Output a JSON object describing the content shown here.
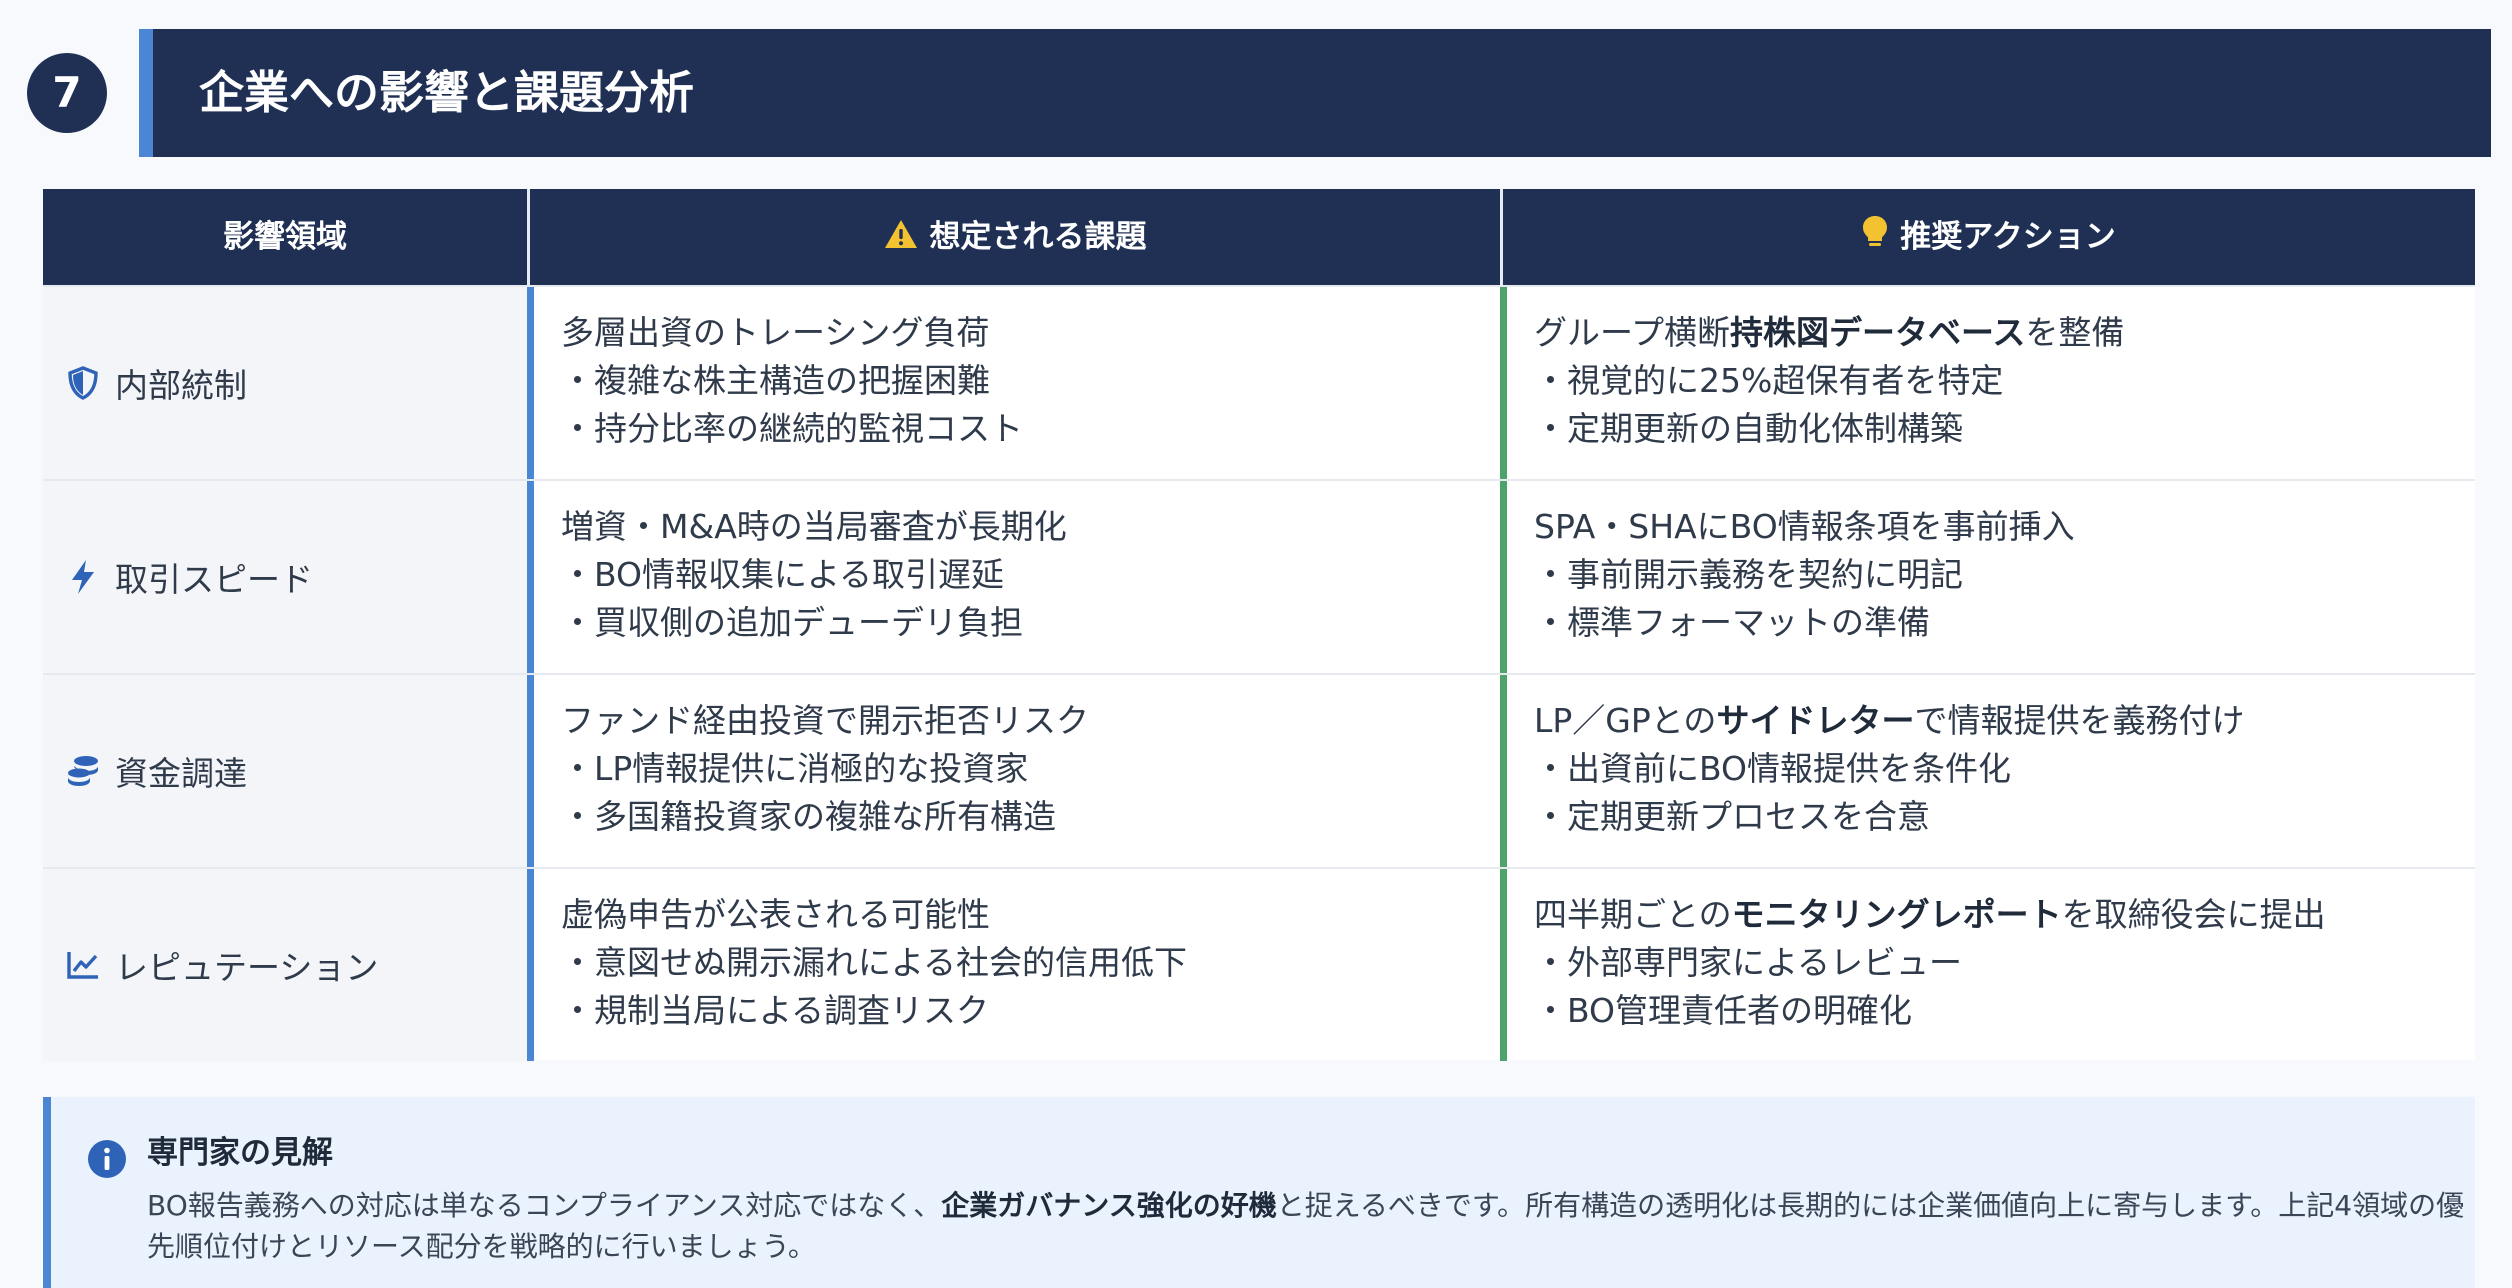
{
  "section": {
    "number": "7",
    "title": "企業への影響と課題分析"
  },
  "table": {
    "headers": {
      "area": "影響領域",
      "issues": "想定される課題",
      "actions": "推奨アクション"
    },
    "rows": [
      {
        "icon": "shield-icon",
        "area": "内部統制",
        "issues": [
          "多層出資のトレーシング負荷",
          "・複雑な株主構造の把握困難",
          "・持分比率の継続的監視コスト"
        ],
        "action_head": {
          "pre": "グループ横断",
          "bold": "持株図データベース",
          "post": "を整備"
        },
        "actions": [
          "・視覚的に25%超保有者を特定",
          "・定期更新の自動化体制構築"
        ]
      },
      {
        "icon": "lightning-icon",
        "area": "取引スピード",
        "issues": [
          "増資・M&A時の当局審査が長期化",
          "・BO情報収集による取引遅延",
          "・買収側の追加デューデリ負担"
        ],
        "action_head": {
          "pre": "SPA・SHAにBO情報条項を事前挿入",
          "bold": "",
          "post": ""
        },
        "actions": [
          "・事前開示義務を契約に明記",
          "・標準フォーマットの準備"
        ]
      },
      {
        "icon": "coins-icon",
        "area": "資金調達",
        "issues": [
          "ファンド経由投資で開示拒否リスク",
          "・LP情報提供に消極的な投資家",
          "・多国籍投資家の複雑な所有構造"
        ],
        "action_head": {
          "pre": "LP／GPとの",
          "bold": "サイドレター",
          "post": "で情報提供を義務付け"
        },
        "actions": [
          "・出資前にBO情報提供を条件化",
          "・定期更新プロセスを合意"
        ]
      },
      {
        "icon": "line-chart-icon",
        "area": "レピュテーション",
        "issues": [
          "虚偽申告が公表される可能性",
          "・意図せぬ開示漏れによる社会的信用低下",
          "・規制当局による調査リスク"
        ],
        "action_head": {
          "pre": "四半期ごとの",
          "bold": "モニタリングレポート",
          "post": "を取締役会に提出"
        },
        "actions": [
          "・外部専門家によるレビュー",
          "・BO管理責任者の明確化"
        ]
      }
    ]
  },
  "insight": {
    "icon": "info-icon",
    "title": "専門家の見解",
    "pre": "BO報告義務への対応は単なるコンプライアンス対応ではなく、",
    "bold": "企業ガバナンス強化の好機",
    "post": "と捉えるべきです。所有構造の透明化は長期的には企業価値向上に寄与します。上記4領域の優先順位付けとリソース配分を戦略的に行いましょう。"
  },
  "colors": {
    "navy": "#1f3054",
    "blue_accent": "#4a86d4",
    "green_accent": "#4ea36c",
    "warning_yellow": "#f2c230",
    "insight_bg": "#eaf2fd"
  }
}
